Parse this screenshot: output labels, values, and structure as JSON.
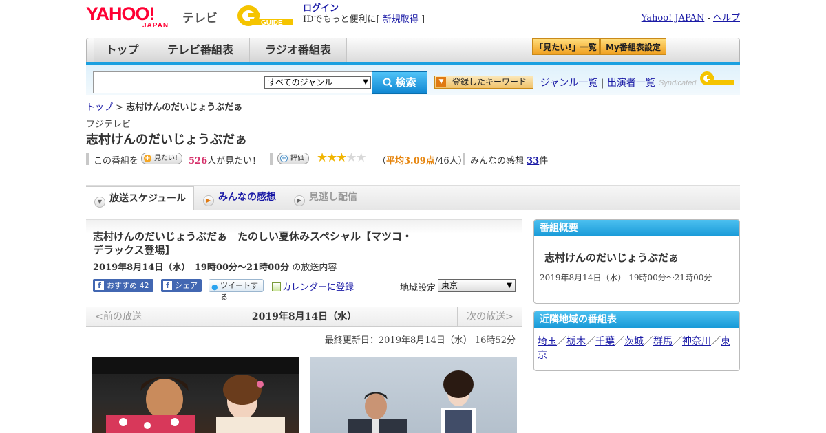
{
  "header": {
    "logo_text": "YAHOO!",
    "logo_sub": "JAPAN",
    "service_name": "テレビ",
    "gguide_logo": "G GUIDE",
    "login_link": "ログイン",
    "login_note_prefix": "IDでもっと便利に[",
    "register_link": "新規取得",
    "login_note_suffix": "]",
    "yahoo_japan_link": "Yahoo! JAPAN",
    "separator": "-",
    "help_link": "ヘルプ"
  },
  "nav": {
    "tabs": [
      "トップ",
      "テレビ番組表",
      "ラジオ番組表"
    ],
    "buttons": [
      "「見たい!」一覧",
      "My番組表設定"
    ]
  },
  "search": {
    "input_value": "",
    "genre_selected": "すべてのジャンル",
    "search_button": "検索",
    "keyword_button": "登録したキーワード",
    "genre_list_link": "ジャンル一覧",
    "divider": "|",
    "performer_list_link": "出演者一覧",
    "syndicated_text": "Syndicated"
  },
  "breadcrumb": {
    "top": "トップ",
    "separator": ">",
    "current": "志村けんのだいじょうぶだぁ"
  },
  "program": {
    "channel": "フジテレビ",
    "title": "志村けんのだいじょうぶだぁ"
  },
  "stats": {
    "prefix": "この番組を",
    "mitai_badge": "見たい!",
    "mitai_count": "526",
    "mitai_suffix": "人が見たい！",
    "rating_badge": "評価",
    "rating_value": 3.09,
    "rating_stars": 3,
    "rating_max": 5,
    "rating_open": "（",
    "rating_avg": "平均3.09点",
    "rating_people": "/46人）",
    "review_label": "みんなの感想",
    "review_count": "33",
    "review_suffix": "件"
  },
  "program_tabs": {
    "schedule": "放送スケジュール",
    "reviews": "みんなの感想",
    "missed": "見逃し配信"
  },
  "detail": {
    "title": "志村けんのだいじょうぶだぁ　たのしい夏休みスペシャル【マツコ・デラックス登場】",
    "date": "2019年8月14日（水）　19時00分～21時00分",
    "date_suffix": "の放送内容",
    "fb_recommend": "おすすめ",
    "fb_recommend_count": "42",
    "fb_share": "シェア",
    "tweet": "ツイートする",
    "calendar_link": "カレンダーに登録",
    "region_label": "地域設定",
    "region_selected": "東京"
  },
  "date_nav": {
    "prev": "<前の放送",
    "current": "2019年8月14日（水）",
    "next": "次の放送>"
  },
  "updated": "最終更新日：2019年8月14日（水）  16時52分",
  "sidebar": {
    "overview_header": "番組概要",
    "overview_title": "志村けんのだいじょうぶだぁ",
    "overview_date": "2019年8月14日（水）  19時00分～21時00分",
    "nearby_header": "近隣地域の番組表",
    "nearby_regions": [
      "埼玉",
      "栃木",
      "千葉",
      "茨城",
      "群馬",
      "神奈川",
      "東京"
    ],
    "nearby_separator": "／"
  },
  "colors": {
    "accent_blue": "#1aa0e0",
    "link": "#1a1aa6",
    "pink": "#d6336c",
    "orange": "#e6850e",
    "star": "#f0b400"
  },
  "icons": {
    "search": "magnifier-icon",
    "plus": "plus-icon",
    "star": "star-icon",
    "circle_arrow": "circle-arrow-icon",
    "facebook": "facebook-icon",
    "twitter": "twitter-bird-icon",
    "calendar": "calendar-icon"
  }
}
